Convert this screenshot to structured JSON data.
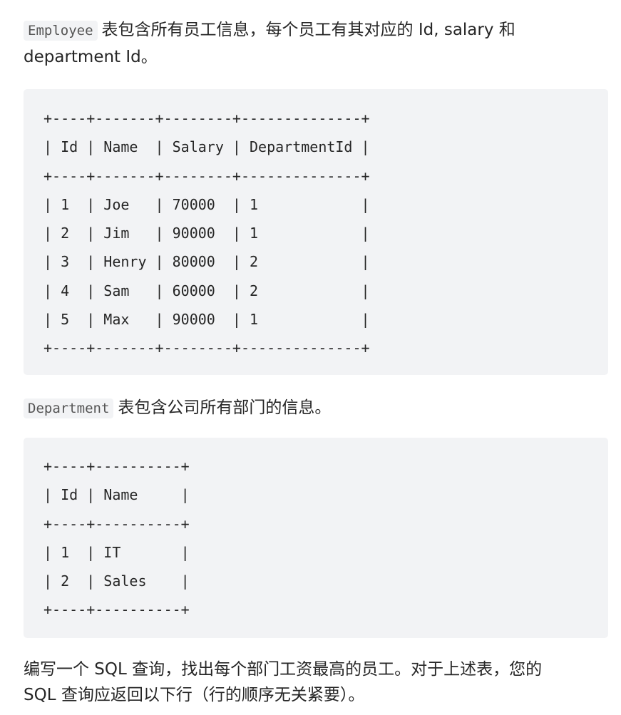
{
  "intro": {
    "table_name": "Employee",
    "text_line1": "表包含所有员工信息，每个员工有其对应的 Id, salary 和",
    "text_line2": "department Id。"
  },
  "employee_table": {
    "lines": [
      "+----+-------+--------+--------------+",
      "| Id | Name  | Salary | DepartmentId |",
      "+----+-------+--------+--------------+",
      "| 1  | Joe   | 70000  | 1            |",
      "| 2  | Jim   | 90000  | 1            |",
      "| 3  | Henry | 80000  | 2            |",
      "| 4  | Sam   | 60000  | 2            |",
      "| 5  | Max   | 90000  | 1            |",
      "+----+-------+--------+--------------+"
    ]
  },
  "department_intro": {
    "table_name": "Department",
    "text": "表包含公司所有部门的信息。"
  },
  "department_table": {
    "lines": [
      "+----+----------+",
      "| Id | Name     |",
      "+----+----------+",
      "| 1  | IT       |",
      "| 2  | Sales    |",
      "+----+----------+"
    ]
  },
  "question": {
    "line1": "编写一个 SQL 查询，找出每个部门工资最高的员工。对于上述表，您的",
    "line2": "SQL 查询应返回以下行（行的顺序无关紧要）。"
  }
}
